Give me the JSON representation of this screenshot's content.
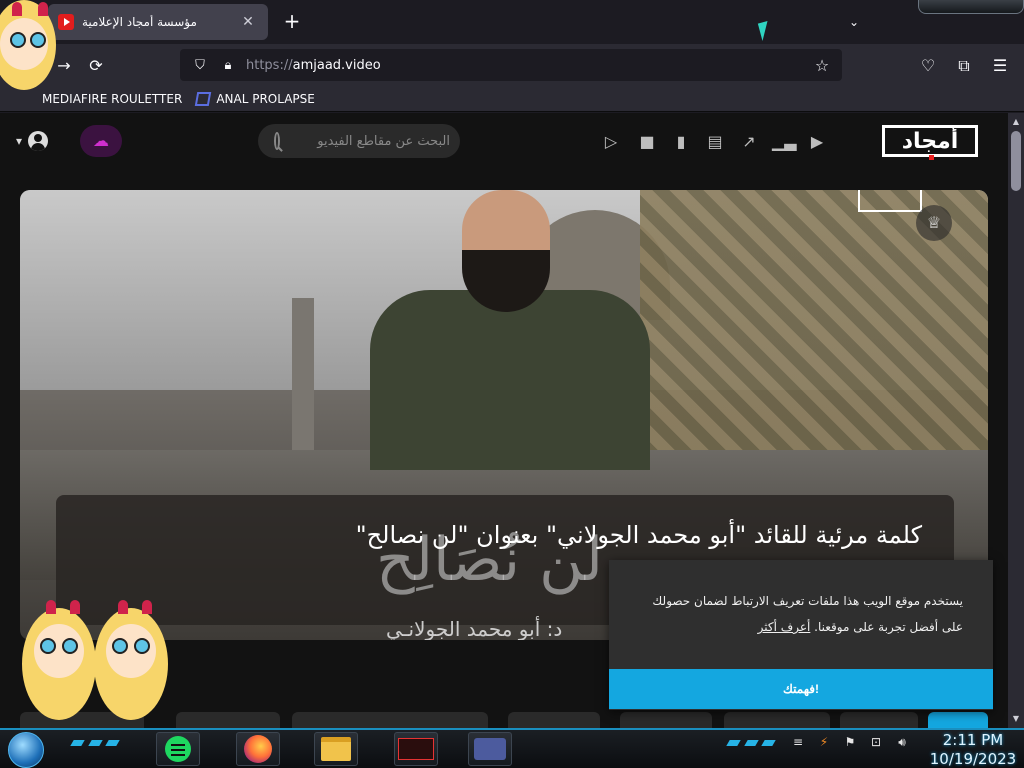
{
  "browser": {
    "tab_title": "مؤسسة أمجاد الإعلامية",
    "new_tab_label": "+",
    "tab_list_label": "⌄",
    "url_scheme": "https://",
    "url_host": "amjaad.video",
    "bookmarks": [
      {
        "label": "MEDIAFIRE ROULETTER"
      },
      {
        "label": "ANAL PROLAPSE"
      }
    ]
  },
  "site": {
    "logo_text": "أمجاد",
    "search_placeholder": "البحث عن مقاطع الفيديو",
    "header_icons": [
      "play-icon",
      "camera-icon",
      "film-icon",
      "clapper-icon",
      "trending-icon",
      "stats-icon",
      "video-icon"
    ],
    "hero": {
      "title": "كلمة مرئية للقائد \"أبو محمد الجولاني\" بعنوان \"لن نصالح\"",
      "brush_text": "لن نُصَالِح",
      "subtitle": "د: أبو محمد الجولانـي"
    },
    "cookie": {
      "text": "يستخدم موقع الويب هذا ملفات تعريف الارتباط لضمان حصولك على أفضل تجربة على موقعنا.",
      "link": "أعرف أكثر",
      "button": "فهمتك!"
    }
  },
  "taskbar": {
    "time": "2:11 PM",
    "date": "10/19/2023",
    "apps": [
      "spotify-app",
      "firefox-app",
      "file-explorer-app",
      "video-app",
      "media-app"
    ]
  },
  "colors": {
    "accent": "#14a7e0",
    "upload_accent": "#d02fcf",
    "taskbar_glow": "#26b3e6"
  }
}
